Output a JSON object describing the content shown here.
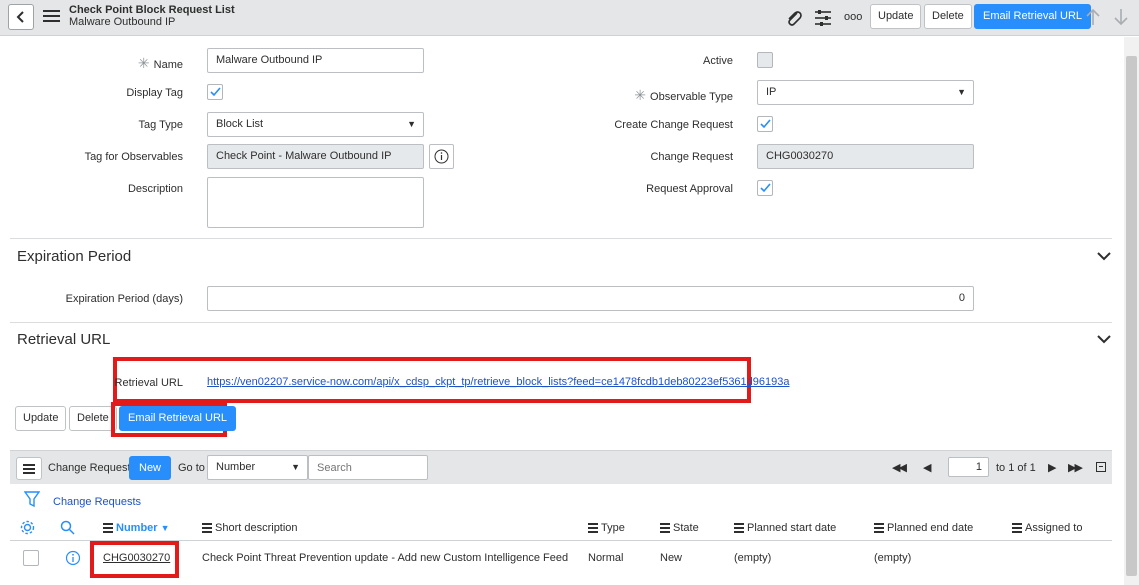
{
  "header": {
    "title": "Check Point Block Request List",
    "subtitle": "Malware Outbound IP",
    "more_label": "ooo",
    "update_label": "Update",
    "delete_label": "Delete",
    "email_label": "Email Retrieval URL"
  },
  "form": {
    "name_label": "Name",
    "name_value": "Malware Outbound IP",
    "display_tag_label": "Display Tag",
    "tag_type_label": "Tag Type",
    "tag_type_value": "Block List",
    "tag_obs_label": "Tag for Observables",
    "tag_obs_value": "Check Point - Malware Outbound IP",
    "description_label": "Description",
    "description_value": "",
    "active_label": "Active",
    "obs_type_label": "Observable Type",
    "obs_type_value": "IP",
    "create_cr_label": "Create Change Request",
    "cr_label": "Change Request",
    "cr_value": "CHG0030270",
    "approval_label": "Request Approval"
  },
  "expiration": {
    "title": "Expiration Period",
    "period_label": "Expiration Period (days)",
    "period_value": "0"
  },
  "retrieval": {
    "title": "Retrieval URL",
    "url_label": "Retrieval URL",
    "url_value": "https://ven02207.service-now.com/api/x_cdsp_ckpt_tp/retrieve_block_lists?feed=ce1478fcdb1deb80223ef5361d96193a"
  },
  "bottom_buttons": {
    "update_label": "Update",
    "delete_label": "Delete",
    "email_label": "Email Retrieval URL"
  },
  "related_list": {
    "title": "Change Requests",
    "new_label": "New",
    "goto_label": "Go to",
    "goto_field": "Number",
    "search_placeholder": "Search",
    "page_value": "1",
    "page_total": "to 1 of 1",
    "breadcrumb": "Change Requests",
    "columns": {
      "number": "Number",
      "short_description": "Short description",
      "type": "Type",
      "state": "State",
      "planned_start": "Planned start date",
      "planned_end": "Planned end date",
      "assigned_to": "Assigned to"
    },
    "rows": [
      {
        "number": "CHG0030270",
        "short_description": "Check Point Threat Prevention update - Add new Custom Intelligence Feed",
        "type": "Normal",
        "state": "New",
        "planned_start": "(empty)",
        "planned_end": "(empty)",
        "assigned_to": ""
      }
    ]
  },
  "colors": {
    "primary": "#278efc",
    "highlight": "#e21a1a",
    "link": "#1e52c8"
  }
}
